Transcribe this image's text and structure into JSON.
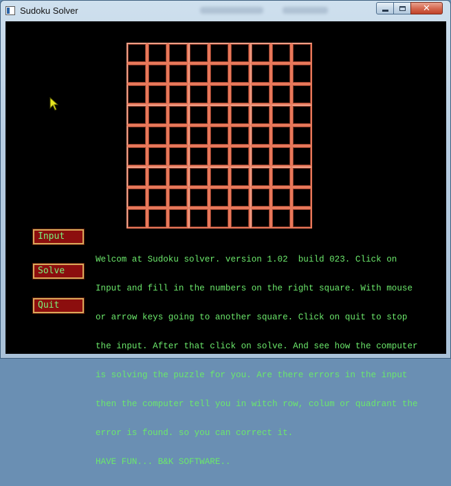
{
  "window": {
    "title": "Sudoku Solver",
    "controls": {
      "minimize_icon": "minimize-icon",
      "maximize_icon": "maximize-icon",
      "close_glyph": "✕"
    }
  },
  "board": {
    "rows": 9,
    "cols": 9,
    "line_color": "#e8785a"
  },
  "buttons": {
    "input_label": "Input",
    "solve_label": "Solve",
    "quit_label": "Quit"
  },
  "intro_lines": [
    "Welcom at Sudoku solver. version 1.02  build 023. Click on",
    "Input and fill in the numbers on the right square. With mouse",
    "or arrow keys going to another square. Click on quit to stop",
    "the input. After that click on solve. And see how the computer",
    "is solving the puzzle for you. Are there errors in the input",
    "then the computer tell you in witch row, colum or quadrant the",
    "error is found. so you can correct it.",
    "HAVE FUN... B&K SOFTWARE.."
  ],
  "colors": {
    "text_green": "#6be86b",
    "button_bg": "#8c0e0e",
    "button_border": "#d9a85a",
    "background": "#000000"
  }
}
